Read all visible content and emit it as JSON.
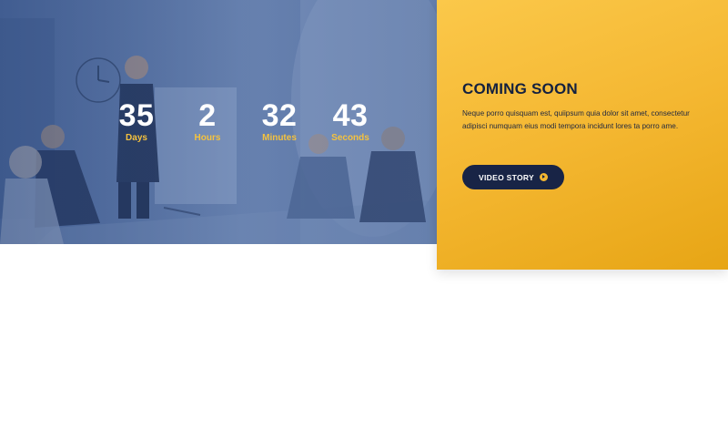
{
  "hero": {
    "background_image": "business-meeting-presentation-photo",
    "overlay_color": "#3a568c"
  },
  "countdown": [
    {
      "value": "35",
      "label": "Days"
    },
    {
      "value": "2",
      "label": "Hours"
    },
    {
      "value": "32",
      "label": "Minutes"
    },
    {
      "value": "43",
      "label": "Seconds"
    }
  ],
  "panel": {
    "title": "COMING SOON",
    "text": "Neque porro quisquam est, quiipsum quia dolor sit amet, consectetur adipisci numquam eius modi tempora incidunt lores ta porro ame.",
    "button_label": "VIDEO STORY",
    "button_icon": "play-circle-icon",
    "accent_color": "#f4b731",
    "button_color": "#182446"
  }
}
